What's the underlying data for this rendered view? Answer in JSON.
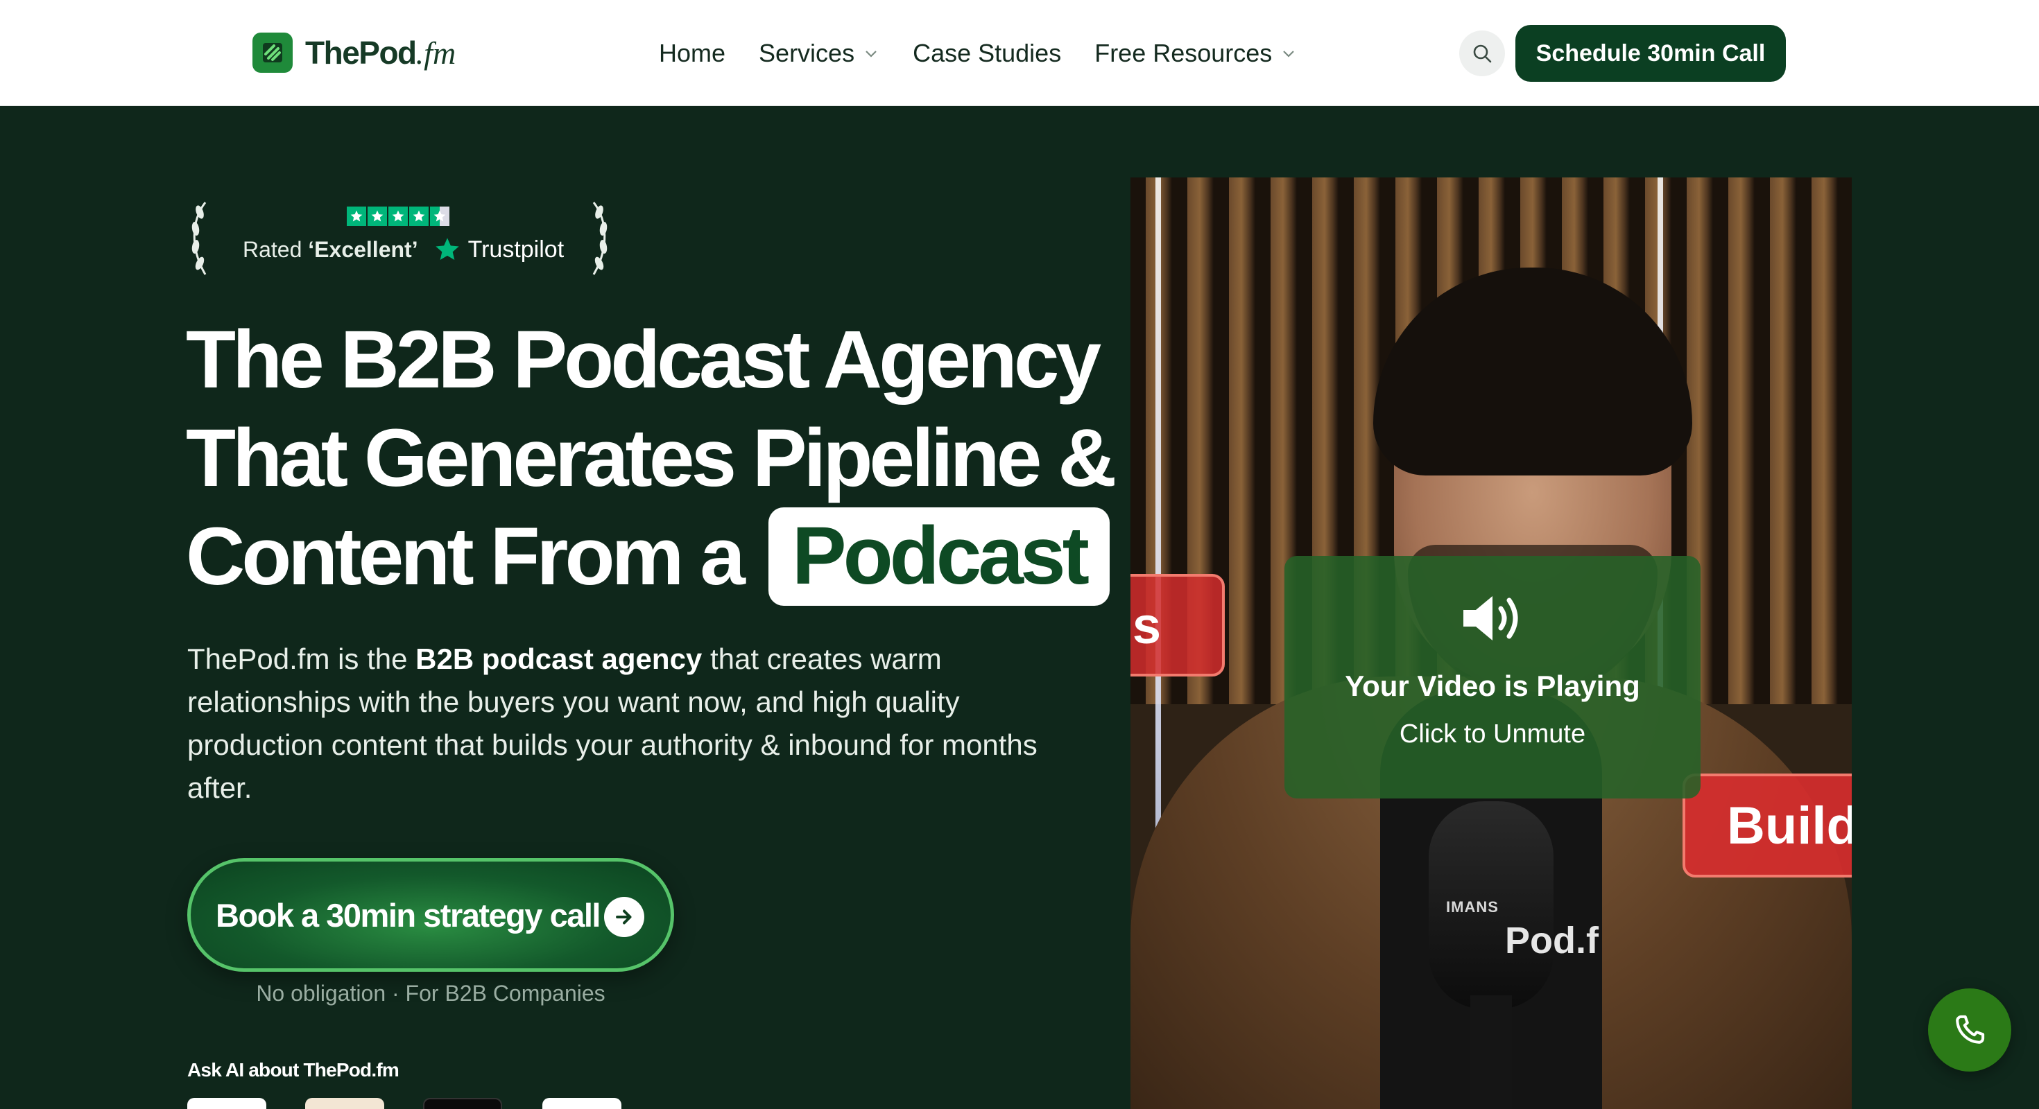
{
  "header": {
    "logo": {
      "brand": "ThePod",
      "suffix": ".fm"
    },
    "nav": [
      {
        "label": "Home",
        "has_dropdown": false
      },
      {
        "label": "Services",
        "has_dropdown": true
      },
      {
        "label": "Case Studies",
        "has_dropdown": false
      },
      {
        "label": "Free Resources",
        "has_dropdown": true
      }
    ],
    "search_icon": "search-icon",
    "cta_label": "Schedule 30min Call"
  },
  "hero": {
    "trust": {
      "rated_prefix": "Rated ",
      "rated_word": "‘Excellent’",
      "provider": "Trustpilot",
      "stars": 4.5
    },
    "headline": {
      "line1": "The B2B Podcast Agency",
      "line2": "That Generates Pipeline &",
      "line3": "Content From a",
      "highlight": "Podcast"
    },
    "intro": {
      "part1": "ThePod.fm is the ",
      "bold": "B2B podcast agency",
      "part2": " that creates warm relationships with the buyers you want now, and high quality production content that builds your authority & inbound for months after."
    },
    "book_button": "Book a 30min strategy call",
    "book_sub": "No obligation · For B2B Companies",
    "ask_ai": "Ask AI about ThePod.fm"
  },
  "video": {
    "overlay_title": "Your Video is Playing",
    "overlay_sub": "Click to Unmute",
    "tag_left": "s",
    "tag_right": "Build",
    "mic_brand": "IMANS",
    "shirt_text": "Pod.f"
  },
  "colors": {
    "brand_dark": "#0b3f22",
    "hero_bg": "#0f271b",
    "accent_green": "#56c46a",
    "trustpilot": "#00b67a",
    "alert_red": "#d62e2e"
  }
}
